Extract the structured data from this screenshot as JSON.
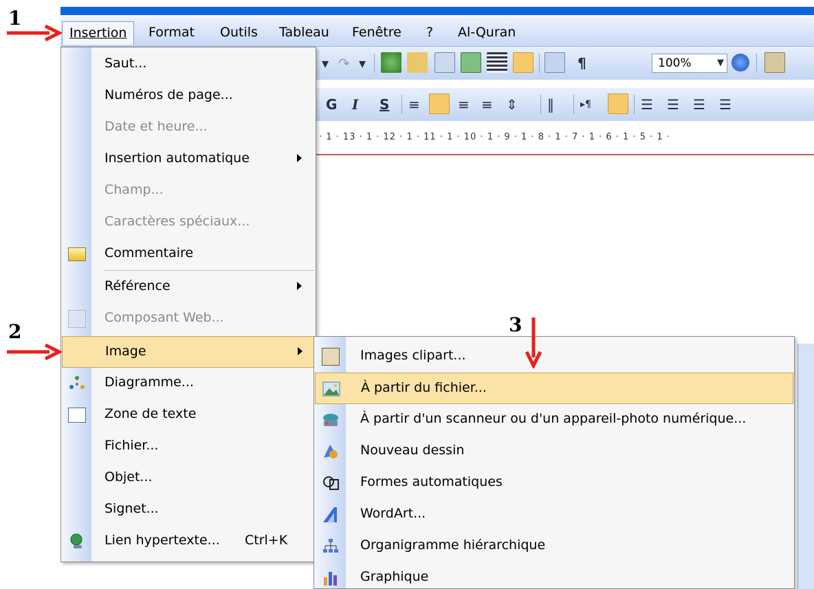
{
  "menubar": {
    "items": [
      "Insertion",
      "Format",
      "Outils",
      "Tableau",
      "Fenêtre",
      "?",
      "Al-Quran"
    ]
  },
  "toolbar": {
    "zoom": "100%",
    "bold_label": "G",
    "italic_label": "I",
    "strike_label": "S",
    "pilcrow": "¶"
  },
  "ruler": {
    "scale": "· 1 · 13 · 1 · 12 · 1 · 11 · 1 · 10 · 1 · 9 · 1 · 8 · 1 · 7 · 1 · 6 · 1 · 5 · 1 ·"
  },
  "insert_menu": {
    "items": [
      {
        "label": "Saut...",
        "icon": "none"
      },
      {
        "label": "Numéros de page...",
        "icon": "none"
      },
      {
        "label": "Date et heure...",
        "icon": "none",
        "disabled": true
      },
      {
        "label": "Insertion automatique",
        "icon": "none",
        "submenu": true
      },
      {
        "label": "Champ...",
        "icon": "none",
        "disabled": true
      },
      {
        "label": "Caractères spéciaux...",
        "icon": "none",
        "disabled": true
      },
      {
        "label": "Commentaire",
        "icon": "comment-icon"
      },
      {
        "label": "Référence",
        "icon": "none",
        "submenu": true
      },
      {
        "label": "Composant Web...",
        "icon": "web-component-icon",
        "disabled": true
      },
      {
        "label": "Image",
        "icon": "none",
        "submenu": true,
        "highlighted": true
      },
      {
        "label": "Diagramme...",
        "icon": "diagram-icon"
      },
      {
        "label": "Zone de texte",
        "icon": "textbox-icon"
      },
      {
        "label": "Fichier...",
        "icon": "none"
      },
      {
        "label": "Objet...",
        "icon": "none"
      },
      {
        "label": "Signet...",
        "icon": "none"
      },
      {
        "label": "Lien hypertexte...",
        "icon": "hyperlink-icon",
        "shortcut": "Ctrl+K"
      }
    ]
  },
  "image_submenu": {
    "items": [
      {
        "label": "Images clipart...",
        "icon": "clipart-icon"
      },
      {
        "label": "À partir du fichier...",
        "icon": "from-file-icon",
        "highlighted": true
      },
      {
        "label": "À partir d'un scanneur ou d'un appareil-photo numérique...",
        "icon": "scanner-icon"
      },
      {
        "label": "Nouveau dessin",
        "icon": "drawing-icon"
      },
      {
        "label": "Formes automatiques",
        "icon": "autoshapes-icon"
      },
      {
        "label": "WordArt...",
        "icon": "wordart-icon"
      },
      {
        "label": "Organigramme hiérarchique",
        "icon": "org-chart-icon"
      },
      {
        "label": "Graphique",
        "icon": "chart-icon"
      }
    ]
  },
  "annotations": {
    "step1": "1",
    "step2": "2",
    "step3": "3"
  },
  "colors": {
    "highlight": "#fbe3a8",
    "arrow": "#e8211b",
    "menubar": "#c7d8f5"
  }
}
